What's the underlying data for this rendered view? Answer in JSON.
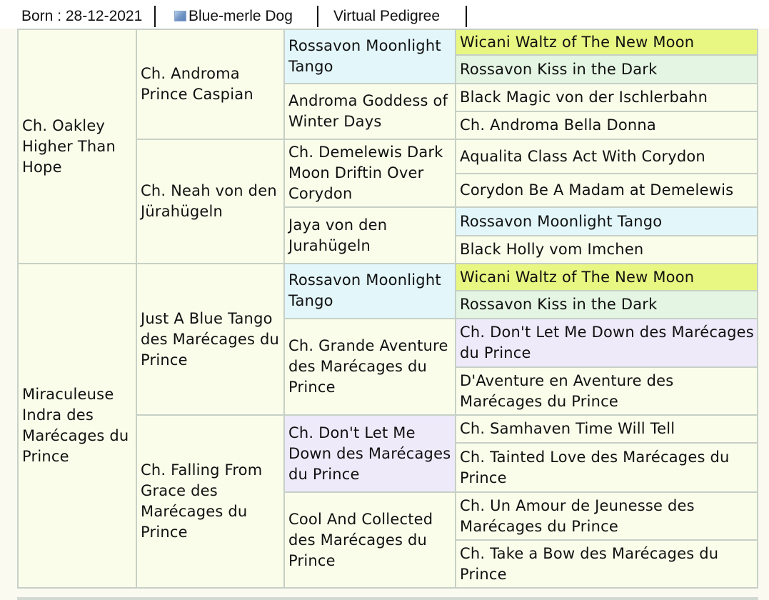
{
  "info_bar": {
    "born": "Born : 28-12-2021",
    "color": "Blue-merle Dog",
    "virtual_pedigree": "Virtual Pedigree",
    "swatch_color": "#6e93c4"
  },
  "colors": {
    "cell_default": "#fbfdeb",
    "blue": "#e3f6fa",
    "green": "#e4f5e3",
    "lime": "#e7f781",
    "lilac": "#eeeafa",
    "border": "#c6d0c6"
  },
  "pedigree": {
    "parents": [
      "Ch. Oakley Higher Than Hope",
      "Miraculeuse Indra des Marécages du Prince"
    ],
    "grandparents": [
      "Ch. Androma Prince Caspian",
      "Ch. Neah von den Jürahügeln",
      "Just A Blue Tango des Marécages du Prince",
      "Ch. Falling From Grace des Marécages du Prince"
    ],
    "great_grandparents": [
      "Rossavon Moonlight Tango",
      "Androma Goddess of Winter Days",
      "Ch. Demelewis Dark Moon Driftin Over Corydon",
      "Jaya von den Jurahügeln",
      "Rossavon Moonlight Tango",
      "Ch. Grande Aventure des Marécages du Prince",
      "Ch. Don't Let Me Down des Marécages du Prince",
      "Cool And Collected des Marécages du Prince"
    ],
    "great_great_grandparents": [
      "Wicani Waltz of The New Moon",
      "Rossavon Kiss in the Dark",
      "Black Magic von der Ischlerbahn",
      "Ch. Androma Bella Donna",
      "Aqualita Class Act With Corydon",
      "Corydon Be A Madam at Demelewis",
      "Rossavon Moonlight Tango",
      "Black Holly vom Imchen",
      "Wicani Waltz of The New Moon",
      "Rossavon Kiss in the Dark",
      "Ch. Don't Let Me Down des Marécages du Prince",
      "D'Aventure en Aventure des Marécages du Prince",
      "Ch. Samhaven Time Will Tell",
      "Ch. Tainted Love des Marécages du Prince",
      "Ch. Un Amour de Jeunesse des Marécages du Prince",
      "Ch. Take a Bow des Marécages du Prince"
    ]
  }
}
